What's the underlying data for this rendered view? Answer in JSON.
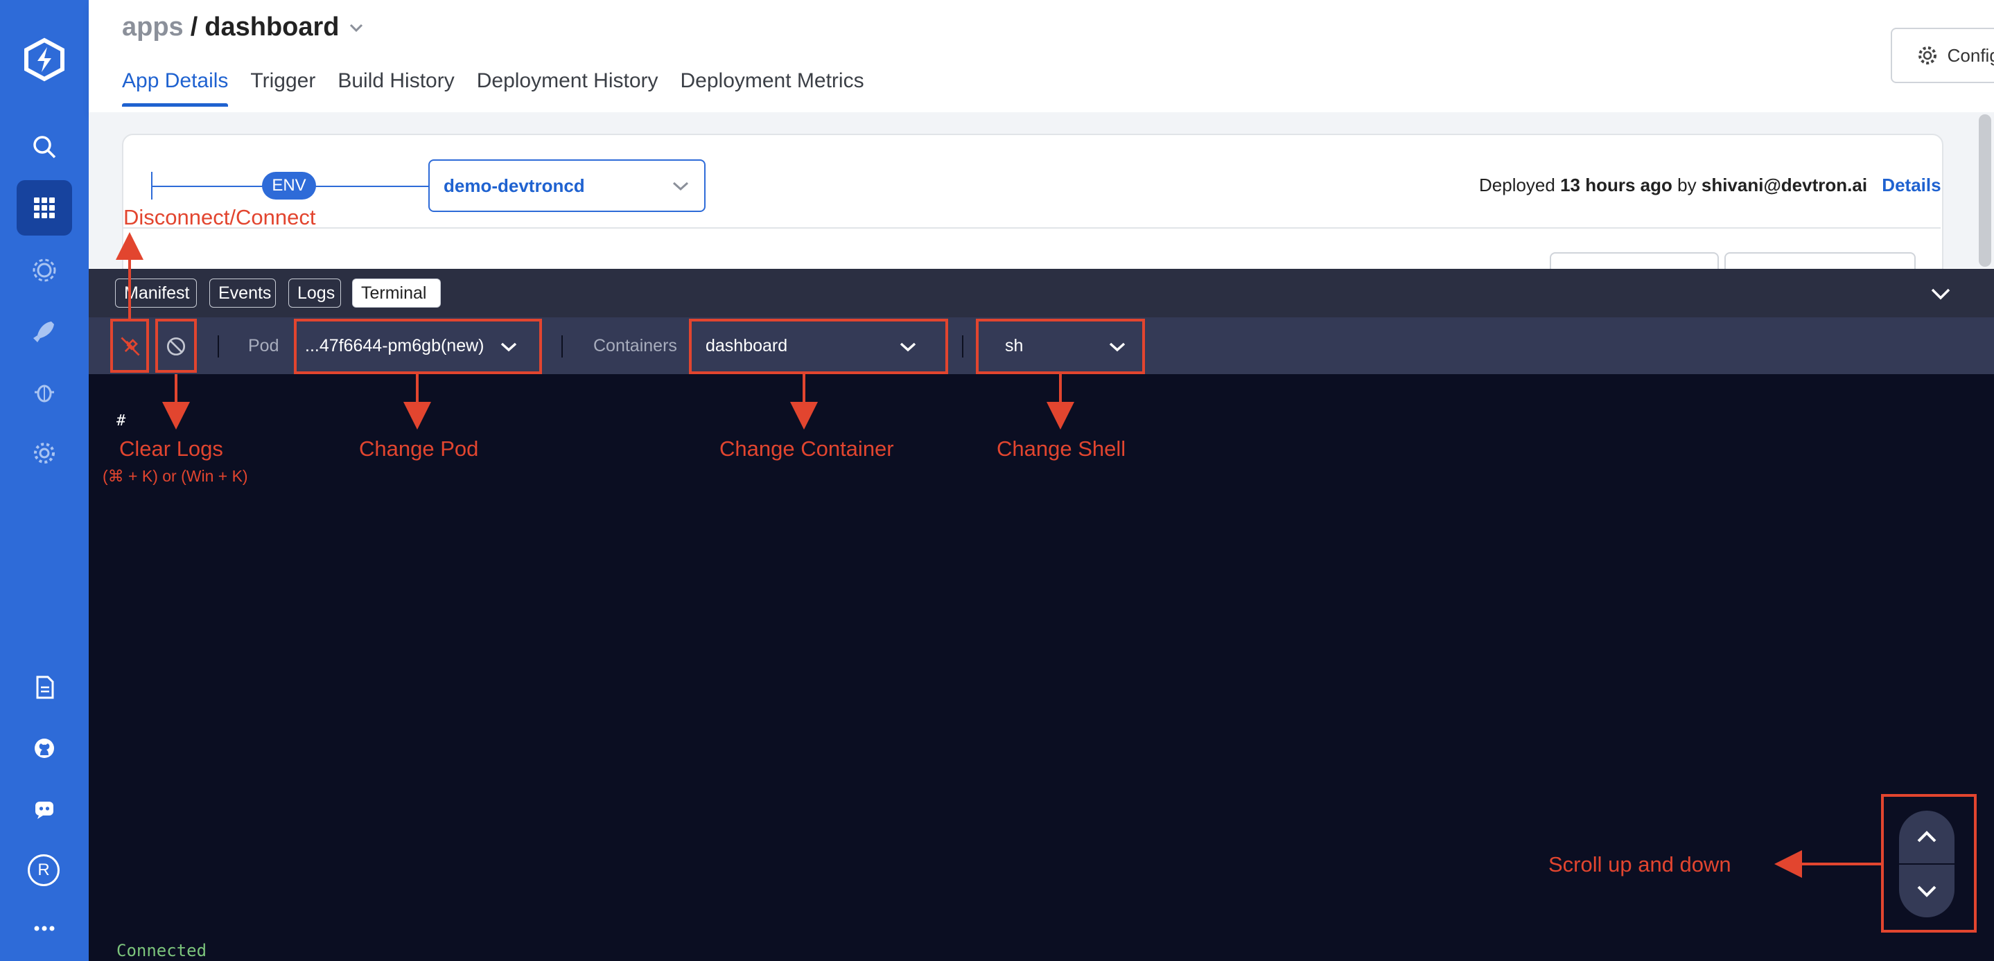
{
  "header": {
    "breadcrumb_parent": "apps",
    "breadcrumb_separator": "/",
    "breadcrumb_current": "dashboard",
    "tabs": [
      {
        "label": "App Details"
      },
      {
        "label": "Trigger"
      },
      {
        "label": "Build History"
      },
      {
        "label": "Deployment History"
      },
      {
        "label": "Deployment Metrics"
      }
    ],
    "configure_label": "Configure"
  },
  "env_card": {
    "env_pill": "ENV",
    "environment": "demo-devtroncd",
    "deployed_prefix": "Deployed",
    "deployed_time": "13 hours ago",
    "deployed_by_word": "by",
    "deployed_user": "shivani@devtron.ai",
    "details_link": "Details"
  },
  "terminal": {
    "tabs": [
      {
        "label": "Manifest"
      },
      {
        "label": "Events"
      },
      {
        "label": "Logs"
      },
      {
        "label": "Terminal"
      }
    ],
    "pod_label": "Pod",
    "pod_value": "...47f6644-pm6gb(new)",
    "containers_label": "Containers",
    "container_value": "dashboard",
    "shell_value": "sh",
    "prompt": "#",
    "status": "Connected"
  },
  "sidebar": {
    "avatar_initial": "R"
  },
  "annotations": {
    "disconnect": "Disconnect/Connect",
    "clear_logs": "Clear Logs",
    "clear_logs_shortcut": "(⌘ + K) or (Win + K)",
    "change_pod": "Change Pod",
    "change_container": "Change Container",
    "change_shell": "Change Shell",
    "scroll": "Scroll up and down"
  },
  "colors": {
    "sidebar": "#2e6bd8",
    "accent": "#1f62d0",
    "terminal_bg": "#0b0e22",
    "annotation": "#e2452f",
    "connected": "#7cc47c"
  }
}
